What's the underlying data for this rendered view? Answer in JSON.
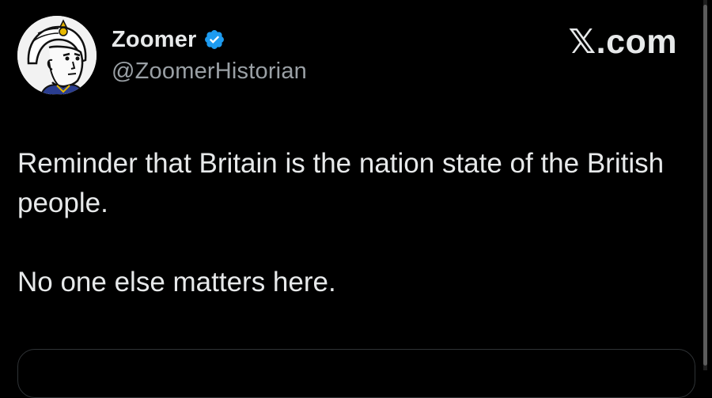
{
  "post": {
    "author": {
      "display_name": "Zoomer",
      "handle": "@ZoomerHistorian",
      "verified": true,
      "avatar_icon": "soldier-avatar-icon"
    },
    "site_label": "𝕏.com",
    "paragraphs": [
      "Reminder that Britain is the nation state of the British people.",
      "No one else matters here."
    ]
  },
  "colors": {
    "background": "#000000",
    "text": "#e7e9ea",
    "secondary_text": "#9aa0a5",
    "verified_badge": "#1d9bf0",
    "border": "#2f3336"
  }
}
